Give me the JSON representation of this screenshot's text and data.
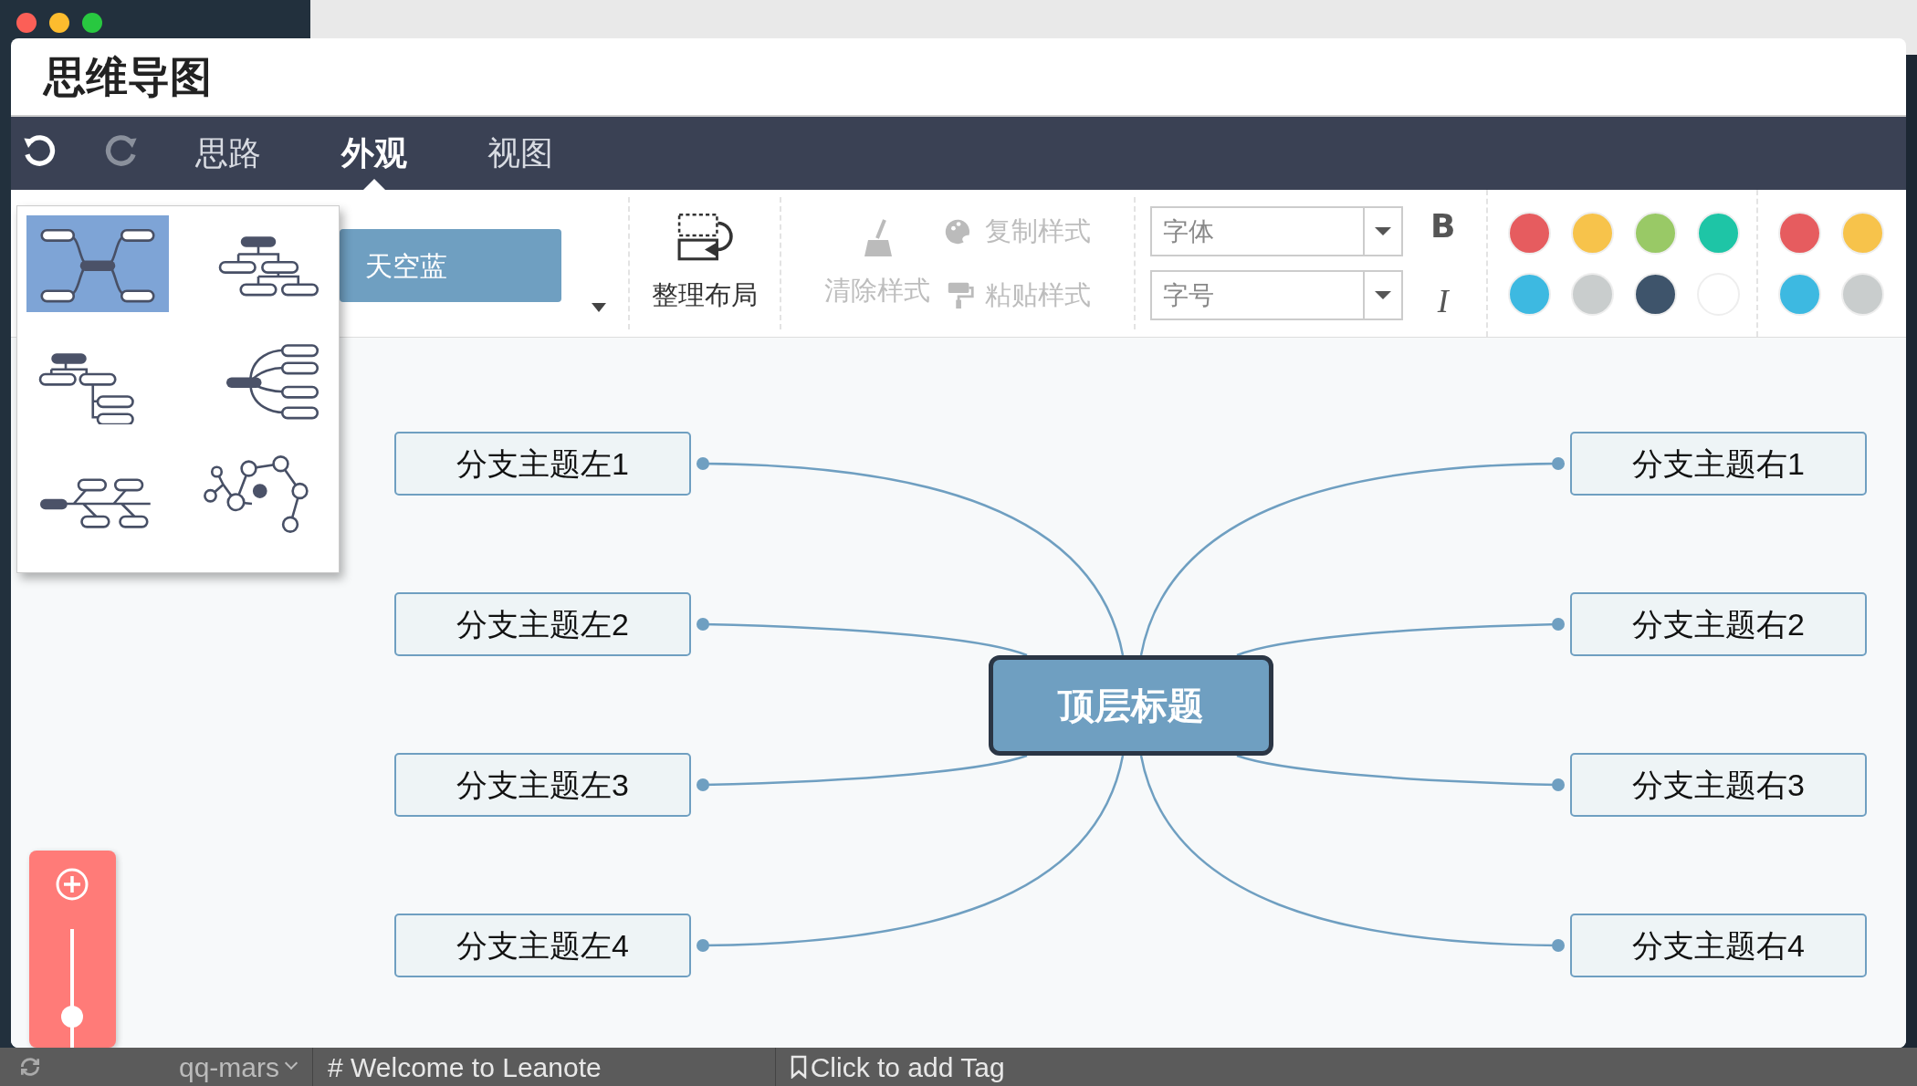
{
  "window": {
    "title": "思维导图"
  },
  "history_buttons": [
    {
      "kind": "undo",
      "disabled": false
    },
    {
      "kind": "redo",
      "disabled": true
    }
  ],
  "tabs": [
    {
      "label": "思路",
      "selected": false
    },
    {
      "label": "外观",
      "selected": true
    },
    {
      "label": "视图",
      "selected": false
    }
  ],
  "layout_menu": [
    {
      "kind": "mindmap",
      "selected": true
    },
    {
      "kind": "org",
      "selected": false
    },
    {
      "kind": "tree",
      "selected": false
    },
    {
      "kind": "fan",
      "selected": false
    },
    {
      "kind": "fishbone",
      "selected": false
    },
    {
      "kind": "network",
      "selected": false
    }
  ],
  "theme": {
    "label": "天空蓝"
  },
  "actions": [
    {
      "kind": "arrange",
      "label": "整理布局",
      "disabled": false
    },
    {
      "kind": "clear",
      "label": "清除样式",
      "disabled": true
    },
    {
      "kind": "copy",
      "label": "复制样式",
      "disabled": true
    },
    {
      "kind": "paste",
      "label": "粘贴样式",
      "disabled": true
    }
  ],
  "font_selects": [
    {
      "placeholder": "字体"
    },
    {
      "placeholder": "字号"
    }
  ],
  "format_buttons": [
    {
      "kind": "bold",
      "label": "B"
    },
    {
      "kind": "italic",
      "label": "I"
    }
  ],
  "color_groups": [
    [
      {
        "color": "#e65c5f"
      },
      {
        "color": "#f7c34b"
      },
      {
        "color": "#99c966"
      },
      {
        "color": "#1ec5a6"
      },
      {
        "color": "#3db9e1"
      },
      {
        "color": "#c9cdcd"
      },
      {
        "color": "#3e546b"
      },
      {
        "color": "#ffffff"
      }
    ],
    [
      {
        "color": "#e65c5f"
      },
      {
        "color": "#f7c34b"
      },
      {
        "color": "#3db9e1"
      },
      {
        "color": "#c9cdcd"
      }
    ]
  ],
  "mind_map": {
    "root": "顶层标题",
    "left": [
      "分支主题左1",
      "分支主题左2",
      "分支主题左3",
      "分支主题左4"
    ],
    "right": [
      "分支主题右1",
      "分支主题右2",
      "分支主题右3",
      "分支主题右4"
    ]
  },
  "zoom": {
    "level": 0.26
  },
  "background": {
    "account": "qq-mars",
    "note_title": "# Welcome to Leanote",
    "tag_prompt": "Click to add Tag"
  }
}
